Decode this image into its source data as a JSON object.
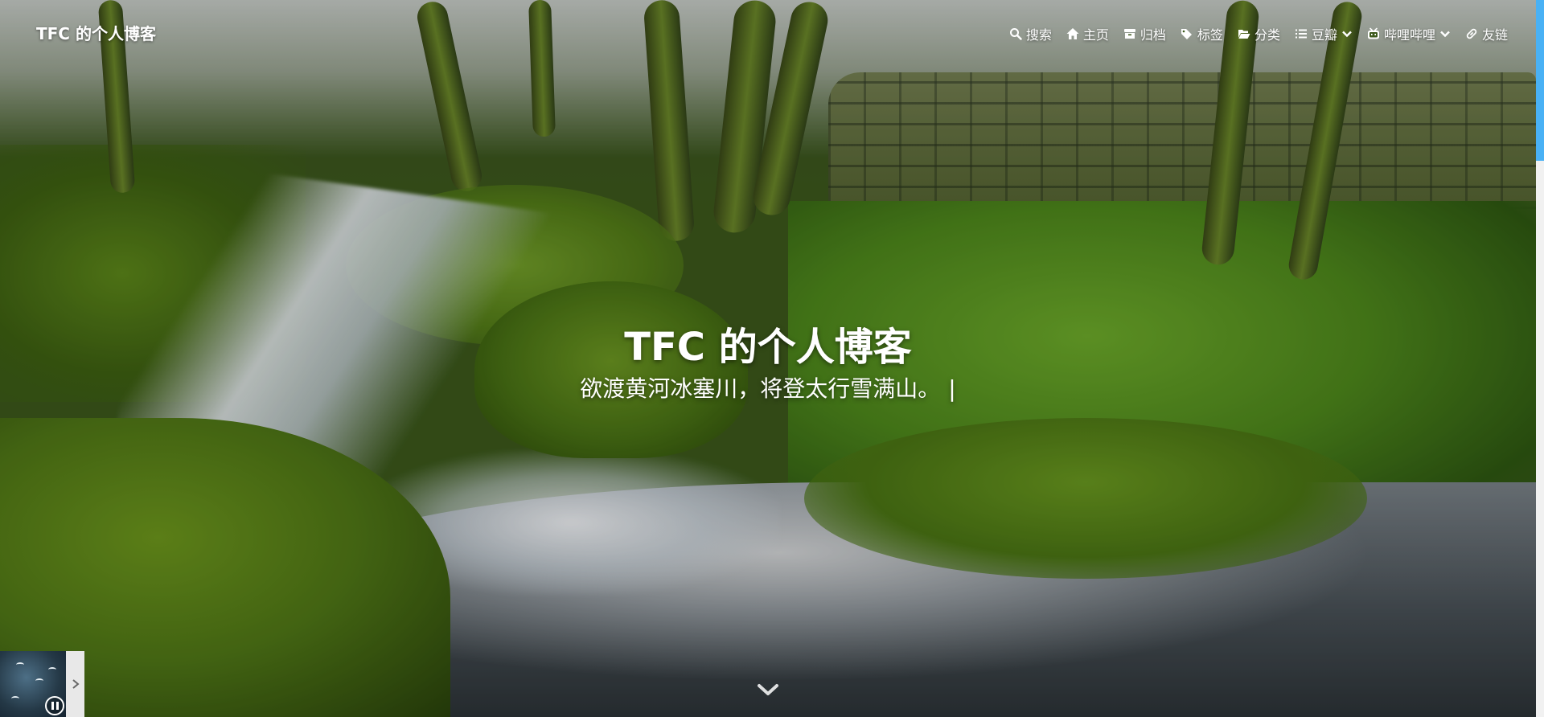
{
  "site": {
    "brand": "TFC 的个人博客"
  },
  "nav": {
    "items": [
      {
        "label": "搜索",
        "icon": "search-icon"
      },
      {
        "label": "主页",
        "icon": "home-icon"
      },
      {
        "label": "归档",
        "icon": "archive-icon"
      },
      {
        "label": "标签",
        "icon": "tags-icon"
      },
      {
        "label": "分类",
        "icon": "folder-open-icon"
      },
      {
        "label": "豆瓣",
        "icon": "list-icon",
        "dropdown": true
      },
      {
        "label": "哔哩哔哩",
        "icon": "bilibili-icon",
        "dropdown": true
      },
      {
        "label": "友链",
        "icon": "link-icon"
      }
    ]
  },
  "hero": {
    "title": "TFC 的个人博客",
    "subtitle": "欲渡黄河冰塞川，将登太行雪满山。",
    "cursor": "|"
  },
  "colors": {
    "scrollbar_thumb": "#49b1f5",
    "nav_text": "#ffffff"
  },
  "player": {
    "state": "playing"
  }
}
